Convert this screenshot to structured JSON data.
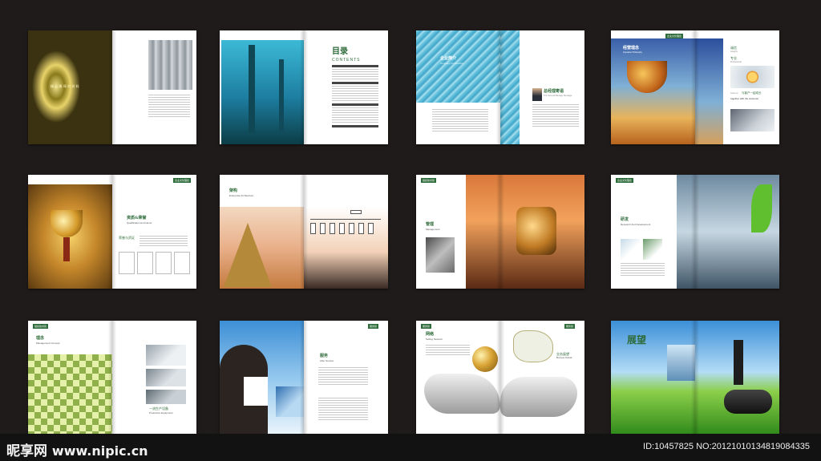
{
  "spreads": {
    "s1": {
      "tagline": "精 心 雕 琢 的 材 料"
    },
    "s2": {
      "title": "目录",
      "subtitle": "CONTENTS"
    },
    "s3": {
      "title": "企业简介",
      "subtitle": "Company Introduction",
      "gm_title": "总经理寄语",
      "gm_sub": "The General Manager Message"
    },
    "s4": {
      "tag": "企业文化理念",
      "title": "经营理念",
      "subtitle": "Operation Philosophy",
      "r1": "诚信",
      "r1en": "Integrity",
      "r2": "专业",
      "r2en": "Professional",
      "r3": "与客户一起成长",
      "r3en": "together with the customer",
      "r0": "Grow up"
    },
    "s5": {
      "tag": "企业文化理念",
      "title": "资质&荣誉",
      "subtitle": "Qualification And Honor",
      "sub2": "荣誉与资证"
    },
    "s6": {
      "title": "架构",
      "subtitle": "Enterprise Architecture"
    },
    "s7": {
      "tag": "组织技术篇",
      "title": "管理",
      "subtitle": "Management"
    },
    "s8": {
      "tag": "企业文化理念",
      "title": "研发",
      "subtitle": "Research And Development"
    },
    "s9": {
      "tag": "组织技术篇",
      "title": "理念",
      "subtitle": "Management Concept",
      "r_title": "一流生产设备",
      "r_sub": "Production Equipment"
    },
    "s10": {
      "tag": "服务篇",
      "title": "服务",
      "subtitle": "After Service"
    },
    "s11": {
      "tag": "服务篇",
      "title": "网络",
      "subtitle": "Selling Network",
      "r_title": "业务展望",
      "r_sub": "Business Outlook"
    },
    "s12": {
      "title": "展望"
    }
  },
  "footer": {
    "logo_cn": "昵享网",
    "logo_url": "www.nipic.cn",
    "image_id": "ID:10457825 NO:20121010134819084335"
  },
  "colors": {
    "background": "#1f1b1b",
    "accent_green": "#2e6b3a"
  }
}
